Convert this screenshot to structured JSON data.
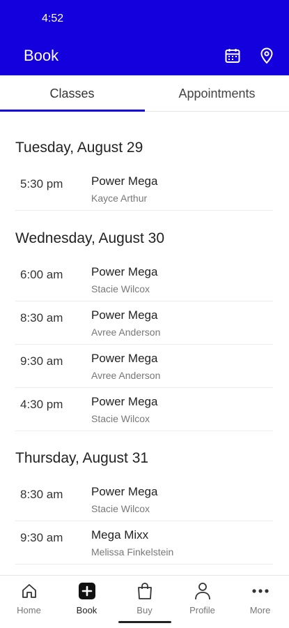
{
  "status_bar": {
    "time": "4:52"
  },
  "app_bar": {
    "title": "Book",
    "icons": [
      "calendar-icon",
      "location-pin-icon"
    ],
    "color": "#1400dd"
  },
  "tabs": [
    {
      "label": "Classes",
      "active": true
    },
    {
      "label": "Appointments",
      "active": false
    }
  ],
  "schedule": [
    {
      "day": "Tuesday, August 29",
      "classes": [
        {
          "time": "5:30 pm",
          "name": "Power Mega",
          "instructor": "Kayce Arthur"
        }
      ]
    },
    {
      "day": "Wednesday, August 30",
      "classes": [
        {
          "time": "6:00 am",
          "name": "Power Mega",
          "instructor": "Stacie Wilcox"
        },
        {
          "time": "8:30 am",
          "name": "Power Mega",
          "instructor": "Avree Anderson"
        },
        {
          "time": "9:30 am",
          "name": "Power Mega",
          "instructor": "Avree Anderson"
        },
        {
          "time": "4:30 pm",
          "name": "Power Mega",
          "instructor": "Stacie Wilcox"
        }
      ]
    },
    {
      "day": "Thursday, August 31",
      "classes": [
        {
          "time": "8:30 am",
          "name": "Power Mega",
          "instructor": "Stacie Wilcox"
        },
        {
          "time": "9:30 am",
          "name": "Mega Mixx",
          "instructor": "Melissa Finkelstein"
        }
      ]
    }
  ],
  "bottom_nav": [
    {
      "label": "Home",
      "icon": "home-icon"
    },
    {
      "label": "Book",
      "icon": "plus-square-icon",
      "active": true
    },
    {
      "label": "Buy",
      "icon": "shopping-bag-icon"
    },
    {
      "label": "Profile",
      "icon": "person-icon"
    },
    {
      "label": "More",
      "icon": "more-dots-icon"
    }
  ]
}
